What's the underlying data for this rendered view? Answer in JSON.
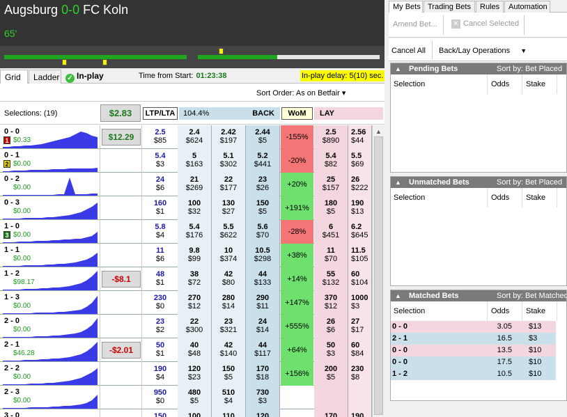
{
  "match": {
    "home": "Augsburg",
    "score": "0-0",
    "away": "FC Koln",
    "minute": "65'"
  },
  "tabs": {
    "grid": "Grid",
    "ladder": "Ladder",
    "inplay": "In-play"
  },
  "time_from_start": {
    "label": "Time from Start:",
    "value": "01:23:38"
  },
  "inplay_delay": "In-play delay: 5(10) sec.",
  "sort_order": "Sort Order: As on Betfair ▾",
  "header": {
    "selections": "Selections: (19)",
    "total_pl": "$2.83",
    "ltp_lta": "LTP/LTA",
    "book_pct": "104.4%",
    "back": "BACK",
    "wom": "WoM",
    "lay": "LAY"
  },
  "colors": {
    "wom_neg": "#f47575",
    "wom_pos": "#6ee06e",
    "pl_pos": "#1a7a1a",
    "pl_neg": "#cc0000"
  },
  "rows": [
    {
      "name": "0 - 0",
      "pl": "$0.33",
      "badge": "1",
      "badge_color": "#cc0000",
      "pl_box": "$12.29",
      "pl_box_neg": false,
      "ltp": "2.5",
      "ltp_s": "$85",
      "b1": "2.4",
      "b1s": "$624",
      "b2": "2.42",
      "b2s": "$197",
      "b3": "2.44",
      "b3s": "$5",
      "wom": "-155%",
      "wom_neg": true,
      "l1": "2.5",
      "l1s": "$890",
      "l2": "2.56",
      "l2s": "$44"
    },
    {
      "name": "0 - 1",
      "pl": "$0.00",
      "badge": "2",
      "badge_color": "#e8d000",
      "pl_box": "",
      "pl_box_neg": false,
      "ltp": "5.4",
      "ltp_s": "$3",
      "b1": "5",
      "b1s": "$163",
      "b2": "5.1",
      "b2s": "$302",
      "b3": "5.2",
      "b3s": "$441",
      "wom": "-20%",
      "wom_neg": true,
      "l1": "5.4",
      "l1s": "$82",
      "l2": "5.5",
      "l2s": "$69"
    },
    {
      "name": "0 - 2",
      "pl": "$0.00",
      "badge": "",
      "badge_color": "",
      "pl_box": "",
      "pl_box_neg": false,
      "ltp": "24",
      "ltp_s": "$6",
      "b1": "21",
      "b1s": "$269",
      "b2": "22",
      "b2s": "$177",
      "b3": "23",
      "b3s": "$26",
      "wom": "+20%",
      "wom_neg": false,
      "l1": "25",
      "l1s": "$157",
      "l2": "26",
      "l2s": "$222"
    },
    {
      "name": "0 - 3",
      "pl": "$0.00",
      "badge": "",
      "badge_color": "",
      "pl_box": "",
      "pl_box_neg": false,
      "ltp": "160",
      "ltp_s": "$1",
      "b1": "100",
      "b1s": "$32",
      "b2": "130",
      "b2s": "$27",
      "b3": "150",
      "b3s": "$5",
      "wom": "+191%",
      "wom_neg": false,
      "l1": "180",
      "l1s": "$5",
      "l2": "190",
      "l2s": "$13"
    },
    {
      "name": "1 - 0",
      "pl": "$0.00",
      "badge": "3",
      "badge_color": "#1a7a1a",
      "pl_box": "",
      "pl_box_neg": false,
      "ltp": "5.8",
      "ltp_s": "$4",
      "b1": "5.4",
      "b1s": "$176",
      "b2": "5.5",
      "b2s": "$622",
      "b3": "5.6",
      "b3s": "$70",
      "wom": "-28%",
      "wom_neg": true,
      "l1": "6",
      "l1s": "$451",
      "l2": "6.2",
      "l2s": "$645"
    },
    {
      "name": "1 - 1",
      "pl": "$0.00",
      "badge": "",
      "badge_color": "",
      "pl_box": "",
      "pl_box_neg": false,
      "ltp": "11",
      "ltp_s": "$6",
      "b1": "9.8",
      "b1s": "$99",
      "b2": "10",
      "b2s": "$374",
      "b3": "10.5",
      "b3s": "$298",
      "wom": "+38%",
      "wom_neg": false,
      "l1": "11",
      "l1s": "$70",
      "l2": "11.5",
      "l2s": "$105"
    },
    {
      "name": "1 - 2",
      "pl": "$98.17",
      "badge": "",
      "badge_color": "",
      "pl_box": "-$8.1",
      "pl_box_neg": true,
      "ltp": "48",
      "ltp_s": "$1",
      "b1": "38",
      "b1s": "$72",
      "b2": "42",
      "b2s": "$80",
      "b3": "44",
      "b3s": "$133",
      "wom": "+14%",
      "wom_neg": false,
      "l1": "55",
      "l1s": "$132",
      "l2": "60",
      "l2s": "$104"
    },
    {
      "name": "1 - 3",
      "pl": "$0.00",
      "badge": "",
      "badge_color": "",
      "pl_box": "",
      "pl_box_neg": false,
      "ltp": "230",
      "ltp_s": "$0",
      "b1": "270",
      "b1s": "$12",
      "b2": "280",
      "b2s": "$14",
      "b3": "290",
      "b3s": "$11",
      "wom": "+147%",
      "wom_neg": false,
      "l1": "370",
      "l1s": "$12",
      "l2": "1000",
      "l2s": "$3"
    },
    {
      "name": "2 - 0",
      "pl": "$0.00",
      "badge": "",
      "badge_color": "",
      "pl_box": "",
      "pl_box_neg": false,
      "ltp": "23",
      "ltp_s": "$2",
      "b1": "22",
      "b1s": "$300",
      "b2": "23",
      "b2s": "$321",
      "b3": "24",
      "b3s": "$14",
      "wom": "+555%",
      "wom_neg": false,
      "l1": "26",
      "l1s": "$6",
      "l2": "27",
      "l2s": "$17"
    },
    {
      "name": "2 - 1",
      "pl": "$46.28",
      "badge": "",
      "badge_color": "",
      "pl_box": "-$2.01",
      "pl_box_neg": true,
      "ltp": "50",
      "ltp_s": "$1",
      "b1": "40",
      "b1s": "$48",
      "b2": "42",
      "b2s": "$140",
      "b3": "44",
      "b3s": "$117",
      "wom": "+64%",
      "wom_neg": false,
      "l1": "50",
      "l1s": "$3",
      "l2": "60",
      "l2s": "$84"
    },
    {
      "name": "2 - 2",
      "pl": "$0.00",
      "badge": "",
      "badge_color": "",
      "pl_box": "",
      "pl_box_neg": false,
      "ltp": "190",
      "ltp_s": "$4",
      "b1": "120",
      "b1s": "$23",
      "b2": "150",
      "b2s": "$5",
      "b3": "170",
      "b3s": "$18",
      "wom": "+156%",
      "wom_neg": false,
      "l1": "200",
      "l1s": "$5",
      "l2": "230",
      "l2s": "$8"
    },
    {
      "name": "2 - 3",
      "pl": "$0.00",
      "badge": "",
      "badge_color": "",
      "pl_box": "",
      "pl_box_neg": false,
      "ltp": "950",
      "ltp_s": "$0",
      "b1": "480",
      "b1s": "$5",
      "b2": "510",
      "b2s": "$4",
      "b3": "730",
      "b3s": "$3",
      "wom": "",
      "wom_neg": false,
      "l1": "",
      "l1s": "",
      "l2": "",
      "l2s": ""
    },
    {
      "name": "3 - 0",
      "pl": "",
      "badge": "",
      "badge_color": "",
      "pl_box": "",
      "pl_box_neg": false,
      "ltp": "150",
      "ltp_s": "",
      "b1": "100",
      "b1s": "",
      "b2": "110",
      "b2s": "",
      "b3": "120",
      "b3s": "",
      "wom": "",
      "wom_neg": false,
      "l1": "170",
      "l1s": "",
      "l2": "190",
      "l2s": ""
    }
  ],
  "right": {
    "tabs": [
      "My Bets",
      "Trading Bets",
      "Rules",
      "Automation"
    ],
    "amend": "Amend Bet...",
    "cancel_selected": "Cancel Selected",
    "cancel_all": "Cancel All",
    "back_lay_ops": "Back/Lay Operations",
    "pending": {
      "title": "Pending Bets",
      "sort": "Sort by: Bet Placed"
    },
    "unmatched": {
      "title": "Unmatched Bets",
      "sort": "Sort by: Bet Placed"
    },
    "matched": {
      "title": "Matched Bets",
      "sort": "Sort by: Bet Matched"
    },
    "cols": {
      "selection": "Selection",
      "odds": "Odds",
      "stake": "Stake"
    },
    "matched_rows": [
      {
        "name": "0 - 0",
        "odds": "3.05",
        "stake": "$13",
        "side": "lay"
      },
      {
        "name": "2 - 1",
        "odds": "16.5",
        "stake": "$3",
        "side": "back"
      },
      {
        "name": "0 - 0",
        "odds": "13.5",
        "stake": "$10",
        "side": "lay"
      },
      {
        "name": "0 - 0",
        "odds": "17.5",
        "stake": "$10",
        "side": "back"
      },
      {
        "name": "1 - 2",
        "odds": "10.5",
        "stake": "$10",
        "side": "back"
      }
    ]
  }
}
